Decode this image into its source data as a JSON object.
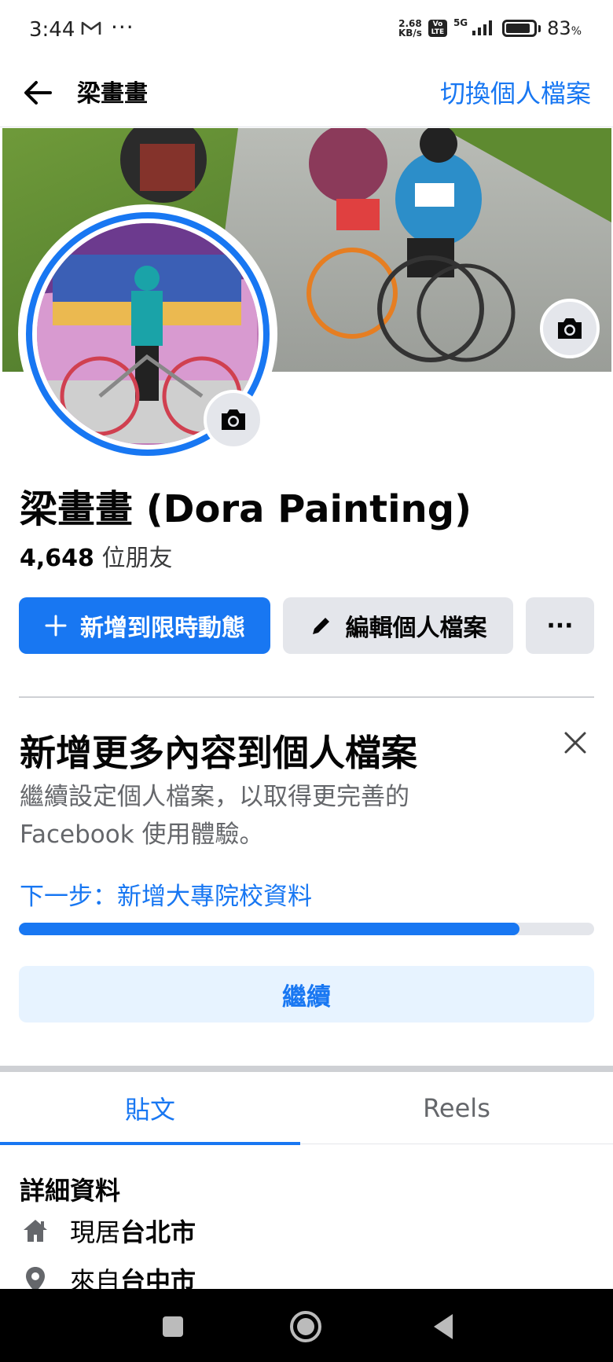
{
  "status_bar": {
    "time": "3:44",
    "mail_icon": "gmail-icon",
    "dots": "···",
    "speed_value": "2.68",
    "speed_unit": "KB/s",
    "volte_top": "Vo",
    "volte_bottom": "LTE",
    "network": "5G",
    "battery_pct": "83",
    "battery_unit": "%"
  },
  "header": {
    "title": "梁畫畫",
    "switch_profile": "切換個人檔案"
  },
  "profile": {
    "name": "梁畫畫 (Dora Painting)",
    "friends_count": "4,648",
    "friends_label": " 位朋友"
  },
  "actions": {
    "add_story": "新增到限時動態",
    "edit_profile": "編輯個人檔案",
    "more": "···"
  },
  "complete_profile": {
    "title": "新增更多內容到個人檔案",
    "description": "繼續設定個人檔案，以取得更完善的 Facebook 使用體驗。",
    "next_step": "下一步：新增大專院校資料",
    "progress": 0.87,
    "continue": "繼續"
  },
  "tabs": [
    {
      "label": "貼文",
      "active": true
    },
    {
      "label": "Reels",
      "active": false
    }
  ],
  "details": {
    "title": "詳細資料",
    "lives_prefix": "現居",
    "lives_city": "台北市",
    "from_prefix": "來自",
    "from_city": "台中市"
  },
  "colors": {
    "brand_blue": "#1877f2",
    "light_blue_bg": "#e7f3ff",
    "gray_button": "#e4e6eb",
    "secondary_text": "#65676b"
  }
}
